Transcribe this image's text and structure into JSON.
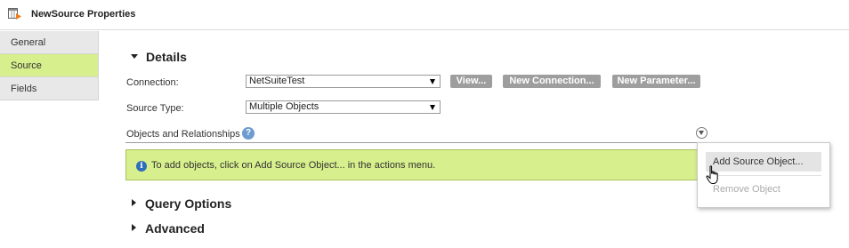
{
  "window": {
    "title": "NewSource Properties"
  },
  "sidebar": {
    "items": [
      {
        "label": "General",
        "active": false
      },
      {
        "label": "Source",
        "active": true
      },
      {
        "label": "Fields",
        "active": false
      }
    ]
  },
  "details": {
    "heading": "Details",
    "connection_label": "Connection:",
    "connection_value": "NetSuiteTest",
    "buttons": {
      "view": "View...",
      "new_connection": "New Connection...",
      "new_parameter": "New Parameter..."
    },
    "source_type_label": "Source Type:",
    "source_type_value": "Multiple Objects",
    "objects_label": "Objects and Relationships",
    "help_icon": "?",
    "info_text": "To add objects, click on Add Source Object... in the actions menu."
  },
  "actions_menu": {
    "items": [
      {
        "label": "Add Source Object...",
        "enabled": true
      },
      {
        "label": "Remove Object",
        "enabled": false
      }
    ]
  },
  "sections": {
    "query_options": "Query Options",
    "advanced": "Advanced"
  },
  "colors": {
    "accent_green": "#d7ef8c",
    "button_gray": "#9e9e9e",
    "info_blue": "#2f6fb9"
  },
  "icons": {
    "window": "source-properties-icon",
    "info": "info-icon",
    "help": "help-icon",
    "actions": "actions-dropdown-icon",
    "cursor": "hand-pointer-icon"
  }
}
